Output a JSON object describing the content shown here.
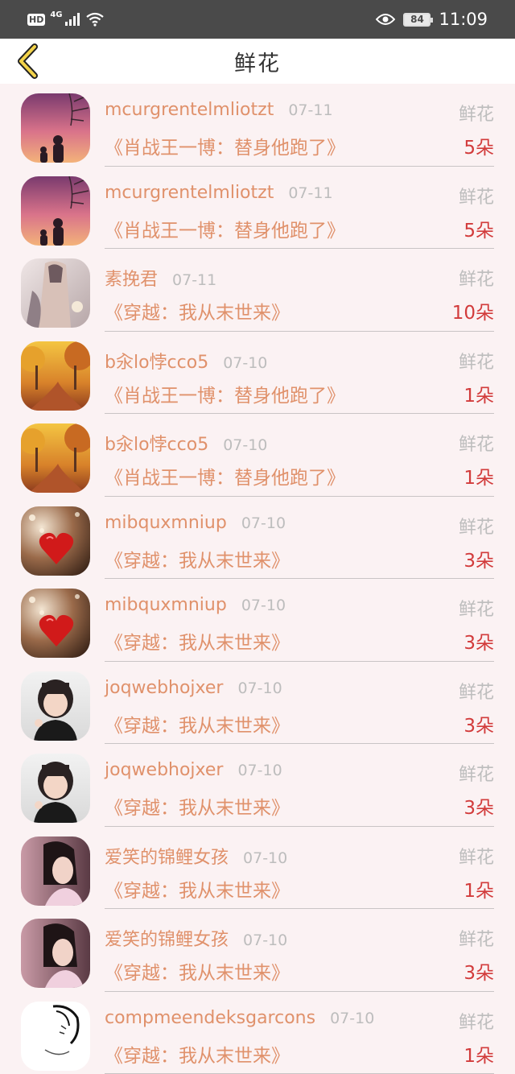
{
  "status_bar": {
    "hd": "HD",
    "network": "4G",
    "battery": "84",
    "time": "11:09"
  },
  "header": {
    "title": "鲜花"
  },
  "records": [
    {
      "user": "mcurgrentelmliotzt",
      "date": "07-11",
      "type": "鲜花",
      "book": "《肖战王一博：替身他跑了》",
      "count": "5朵",
      "avatar": "sunset-girl"
    },
    {
      "user": "mcurgrentelmliotzt",
      "date": "07-11",
      "type": "鲜花",
      "book": "《肖战王一博：替身他跑了》",
      "count": "5朵",
      "avatar": "sunset-girl"
    },
    {
      "user": "素挽君",
      "date": "07-11",
      "type": "鲜花",
      "book": "《穿越：我从末世来》",
      "count": "10朵",
      "avatar": "costume-figure"
    },
    {
      "user": "b汆lo悖cco5",
      "date": "07-10",
      "type": "鲜花",
      "book": "《肖战王一博：替身他跑了》",
      "count": "1朵",
      "avatar": "autumn-road"
    },
    {
      "user": "b汆lo悖cco5",
      "date": "07-10",
      "type": "鲜花",
      "book": "《肖战王一博：替身他跑了》",
      "count": "1朵",
      "avatar": "autumn-road"
    },
    {
      "user": "mibquxmniup",
      "date": "07-10",
      "type": "鲜花",
      "book": "《穿越：我从末世来》",
      "count": "3朵",
      "avatar": "red-heart"
    },
    {
      "user": "mibquxmniup",
      "date": "07-10",
      "type": "鲜花",
      "book": "《穿越：我从末世来》",
      "count": "3朵",
      "avatar": "red-heart"
    },
    {
      "user": "joqwebhojxer",
      "date": "07-10",
      "type": "鲜花",
      "book": "《穿越：我从末世来》",
      "count": "3朵",
      "avatar": "child-photo"
    },
    {
      "user": "joqwebhojxer",
      "date": "07-10",
      "type": "鲜花",
      "book": "《穿越：我从末世来》",
      "count": "3朵",
      "avatar": "child-photo"
    },
    {
      "user": "爱笑的锦鲤女孩",
      "date": "07-10",
      "type": "鲜花",
      "book": "《穿越：我从末世来》",
      "count": "1朵",
      "avatar": "girl-portrait"
    },
    {
      "user": "爱笑的锦鲤女孩",
      "date": "07-10",
      "type": "鲜花",
      "book": "《穿越：我从末世来》",
      "count": "3朵",
      "avatar": "girl-portrait"
    },
    {
      "user": "compmeendeksgarcons",
      "date": "07-10",
      "type": "鲜花",
      "book": "《穿越：我从末世来》",
      "count": "1朵",
      "avatar": "sketch-portrait"
    }
  ]
}
